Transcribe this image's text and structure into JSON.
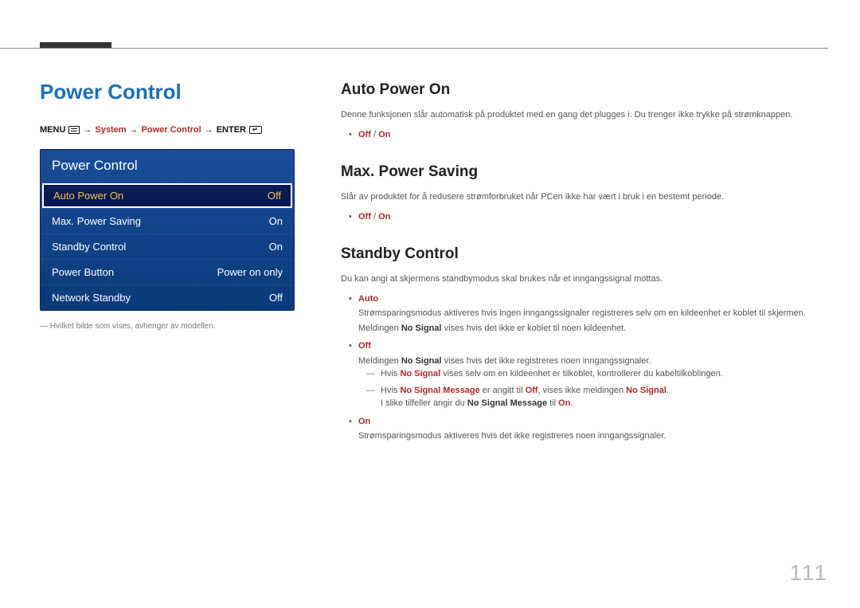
{
  "page_number": "111",
  "left": {
    "title": "Power Control",
    "breadcrumb": {
      "menu": "MENU",
      "arrow": "→",
      "seg1": "System",
      "seg2": "Power Control",
      "enter": "ENTER"
    },
    "osd": {
      "title": "Power Control",
      "rows": [
        {
          "label": "Auto Power On",
          "value": "Off",
          "selected": true
        },
        {
          "label": "Max. Power Saving",
          "value": "On",
          "selected": false
        },
        {
          "label": "Standby Control",
          "value": "On",
          "selected": false
        },
        {
          "label": "Power Button",
          "value": "Power on only",
          "selected": false
        },
        {
          "label": "Network Standby",
          "value": "Off",
          "selected": false
        }
      ]
    },
    "footnote_prefix": "―",
    "footnote": "Hvilket bilde som vises, avhenger av modellen."
  },
  "right": {
    "auto_power_on": {
      "title": "Auto Power On",
      "desc": "Denne funksjonen slår automatisk på produktet med en gang det plugges i. Du trenger ikke trykke på strømknappen.",
      "opt_off": "Off",
      "opt_sep": " / ",
      "opt_on": "On"
    },
    "max_power_saving": {
      "title": "Max. Power Saving",
      "desc": "Slår av produktet for å redusere strømforbruket når PCen ikke har vært i bruk i en bestemt periode.",
      "opt_off": "Off",
      "opt_sep": " / ",
      "opt_on": "On"
    },
    "standby_control": {
      "title": "Standby Control",
      "desc": "Du kan angi at skjermens standbymodus skal brukes når et inngangssignal mottas.",
      "auto": {
        "label": "Auto",
        "line1": "Strømsparingsmodus aktiveres hvis ingen inngangssignaler registreres selv om en kildeenhet er koblet til skjermen.",
        "line2_a": "Meldingen ",
        "line2_b": "No Signal",
        "line2_c": " vises hvis det ikke er koblet til noen kildeenhet."
      },
      "off": {
        "label": "Off",
        "line1_a": "Meldingen ",
        "line1_b": "No Signal",
        "line1_c": " vises hvis det ikke registreres noen inngangssignaler.",
        "dash1_a": "Hvis ",
        "dash1_b": "No Signal",
        "dash1_c": " vises selv om en kildeenhet er tilkoblet, kontrollerer du kabeltilkoblingen.",
        "dash2_a": "Hvis ",
        "dash2_b": "No Signal Message",
        "dash2_c": " er angitt til ",
        "dash2_d": "Off",
        "dash2_e": ", vises ikke meldingen ",
        "dash2_f": "No Signal",
        "dash2_g": ".",
        "dash2_line2_a": "I slike tilfeller angir du ",
        "dash2_line2_b": "No Signal Message",
        "dash2_line2_c": " til ",
        "dash2_line2_d": "On",
        "dash2_line2_e": "."
      },
      "on": {
        "label": "On",
        "line1": "Strømsparingsmodus aktiveres hvis det ikke registreres noen inngangssignaler."
      }
    }
  }
}
